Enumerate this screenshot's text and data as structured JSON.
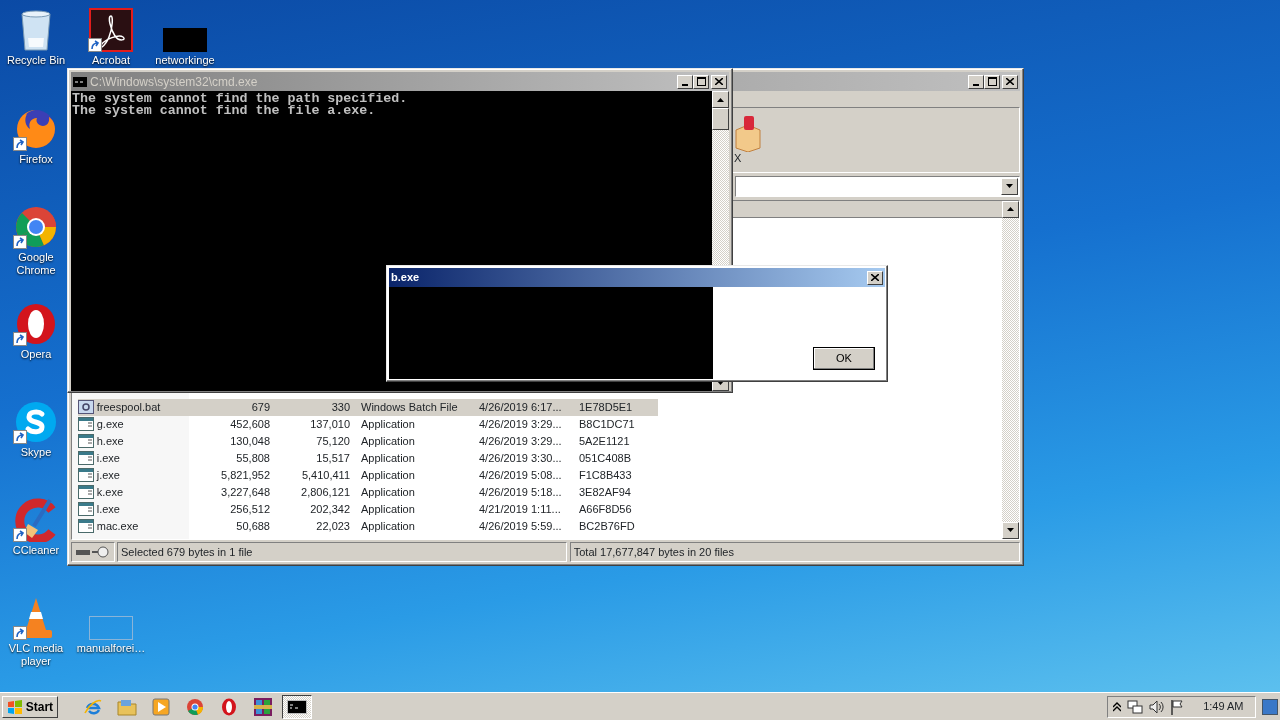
{
  "desktop": {
    "icons": [
      {
        "kind": "recycle-bin",
        "label": "Recycle Bin",
        "shortcut": false
      },
      {
        "kind": "acrobat",
        "label": "Acrobat",
        "shortcut": true
      },
      {
        "kind": "blank",
        "label": "networkinge",
        "shortcut": false
      },
      {
        "kind": "firefox",
        "label": "Firefox",
        "shortcut": true
      },
      {
        "kind": "chrome",
        "label": "Google Chrome",
        "shortcut": true
      },
      {
        "kind": "opera",
        "label": "Opera",
        "shortcut": true
      },
      {
        "kind": "skype",
        "label": "Skype",
        "shortcut": true
      },
      {
        "kind": "ccleaner",
        "label": "CCleaner",
        "shortcut": true
      },
      {
        "kind": "vlc",
        "label": "VLC media player",
        "shortcut": true
      },
      {
        "kind": "document",
        "label": "manualforei…",
        "shortcut": false
      }
    ]
  },
  "archive_window": {
    "toolbar_label": "X",
    "files": [
      {
        "kind": "batch",
        "name": "freespool.bat",
        "size": "679",
        "packed": "330",
        "type": "Windows Batch File",
        "modified": "4/26/2019 6:17...",
        "crc": "1E78D5E1",
        "selected": true
      },
      {
        "kind": "application",
        "name": "g.exe",
        "size": "452,608",
        "packed": "137,010",
        "type": "Application",
        "modified": "4/26/2019 3:29...",
        "crc": "B8C1DC71",
        "selected": false
      },
      {
        "kind": "application",
        "name": "h.exe",
        "size": "130,048",
        "packed": "75,120",
        "type": "Application",
        "modified": "4/26/2019 3:29...",
        "crc": "5A2E1121",
        "selected": false
      },
      {
        "kind": "application",
        "name": "i.exe",
        "size": "55,808",
        "packed": "15,517",
        "type": "Application",
        "modified": "4/26/2019 3:30...",
        "crc": "051C408B",
        "selected": false
      },
      {
        "kind": "application",
        "name": "j.exe",
        "size": "5,821,952",
        "packed": "5,410,411",
        "type": "Application",
        "modified": "4/26/2019 5:08...",
        "crc": "F1C8B433",
        "selected": false
      },
      {
        "kind": "application",
        "name": "k.exe",
        "size": "3,227,648",
        "packed": "2,806,121",
        "type": "Application",
        "modified": "4/26/2019 5:18...",
        "crc": "3E82AF94",
        "selected": false
      },
      {
        "kind": "application",
        "name": "l.exe",
        "size": "256,512",
        "packed": "202,342",
        "type": "Application",
        "modified": "4/21/2019 1:11...",
        "crc": "A66F8D56",
        "selected": false
      },
      {
        "kind": "application",
        "name": "mac.exe",
        "size": "50,688",
        "packed": "22,023",
        "type": "Application",
        "modified": "4/26/2019 5:59...",
        "crc": "BC2B76FD",
        "selected": false
      }
    ],
    "status_bar": {
      "selection": "Selected 679 bytes in 1 file",
      "total": "Total 17,677,847 bytes in 20 files"
    }
  },
  "console_window": {
    "title": "C:\\Windows\\system32\\cmd.exe",
    "lines": [
      "The system cannot find the path specified.",
      "The system cannot find the file a.exe."
    ]
  },
  "dialog": {
    "title": "b.exe",
    "button": "OK"
  },
  "taskbar": {
    "start": "Start",
    "items": [
      {
        "kind": "browser-e",
        "active": false
      },
      {
        "kind": "folder",
        "active": false
      },
      {
        "kind": "media",
        "active": false
      },
      {
        "kind": "chrome",
        "active": false
      },
      {
        "kind": "opera",
        "active": false
      },
      {
        "kind": "archive",
        "active": false
      },
      {
        "kind": "console",
        "active": true
      }
    ],
    "clock": "1:49 AM"
  }
}
